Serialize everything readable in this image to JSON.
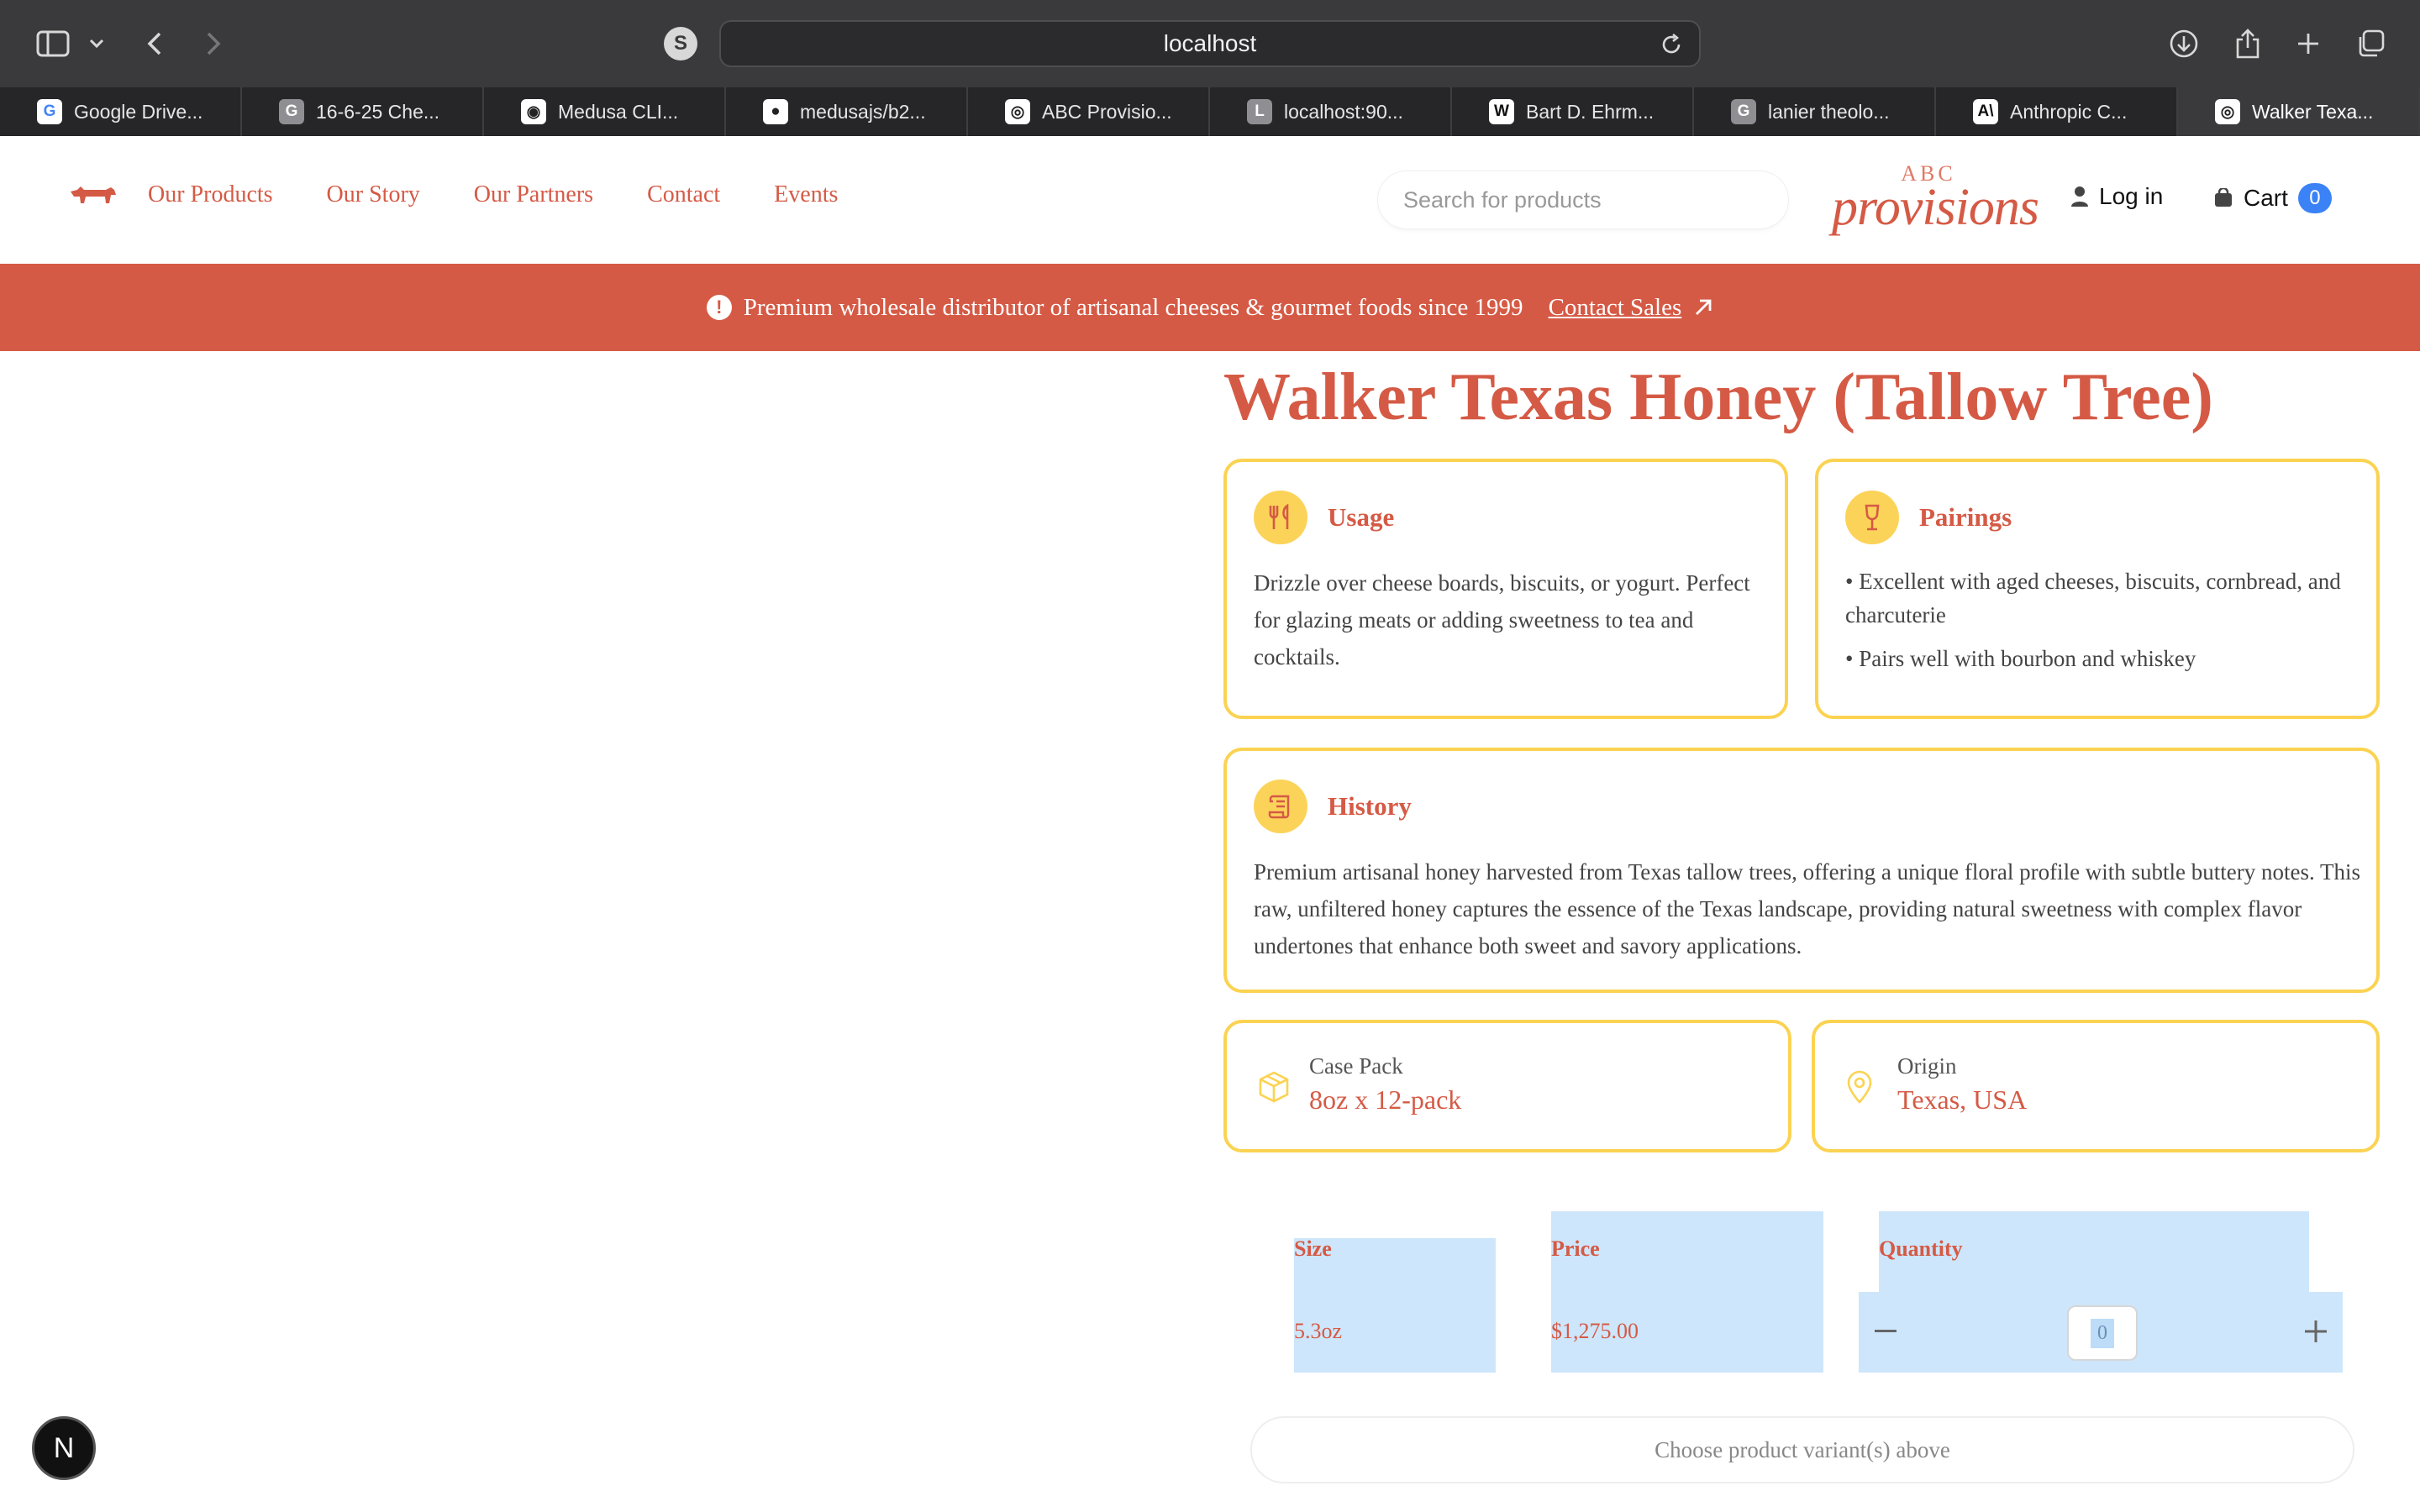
{
  "browser": {
    "url": "localhost",
    "site_badge": "S",
    "tabs": [
      {
        "label": "Google Drive...",
        "fav": "G",
        "fav_color": "#ffffff",
        "fav_fg": "#4285f4"
      },
      {
        "label": "16-6-25 Che...",
        "fav": "G",
        "fav_color": "#8e8e93",
        "fav_fg": "#ffffff"
      },
      {
        "label": "Medusa CLI...",
        "fav": "◉",
        "fav_color": "#ffffff",
        "fav_fg": "#222222"
      },
      {
        "label": "medusajs/b2...",
        "fav": "●",
        "fav_color": "#ffffff",
        "fav_fg": "#222222"
      },
      {
        "label": "ABC Provisio...",
        "fav": "◎",
        "fav_color": "#ffffff",
        "fav_fg": "#222222"
      },
      {
        "label": "localhost:90...",
        "fav": "L",
        "fav_color": "#8e8e93",
        "fav_fg": "#ffffff"
      },
      {
        "label": "Bart D. Ehrm...",
        "fav": "W",
        "fav_color": "#ffffff",
        "fav_fg": "#111111"
      },
      {
        "label": "lanier theolo...",
        "fav": "G",
        "fav_color": "#8e8e93",
        "fav_fg": "#ffffff"
      },
      {
        "label": "Anthropic C...",
        "fav": "A\\",
        "fav_color": "#ffffff",
        "fav_fg": "#111111"
      },
      {
        "label": "Walker Texa...",
        "fav": "◎",
        "fav_color": "#ffffff",
        "fav_fg": "#222222"
      }
    ]
  },
  "header": {
    "nav": [
      "Our Products",
      "Our Story",
      "Our Partners",
      "Contact",
      "Events"
    ],
    "search_placeholder": "Search for products",
    "brand_top": "ABC",
    "brand_main": "provisions",
    "login_label": "Log in",
    "cart_label": "Cart",
    "cart_count": "0"
  },
  "banner": {
    "text": "Premium wholesale distributor of artisanal cheeses & gourmet foods since 1999",
    "link": "Contact Sales"
  },
  "product": {
    "title": "Walker Texas Honey (Tallow Tree)",
    "usage": {
      "title": "Usage",
      "body": "Drizzle over cheese boards, biscuits, or yogurt. Perfect for glazing meats or adding sweetness to tea and cocktails."
    },
    "pairings": {
      "title": "Pairings",
      "items": [
        "• Excellent with aged cheeses, biscuits, cornbread, and charcuterie",
        "• Pairs well with bourbon and whiskey"
      ]
    },
    "history": {
      "title": "History",
      "body": "Premium artisanal honey harvested from Texas tallow trees, offering a unique floral profile with subtle buttery notes. This raw, unfiltered honey captures the essence of the Texas landscape, providing natural sweetness with complex flavor undertones that enhance both sweet and savory applications."
    },
    "case_pack": {
      "label": "Case Pack",
      "value": "8oz x 12-pack"
    },
    "origin": {
      "label": "Origin",
      "value": "Texas, USA"
    }
  },
  "variants": {
    "headers": {
      "size": "Size",
      "price": "Price",
      "quantity": "Quantity"
    },
    "rows": [
      {
        "size": "5.3oz",
        "price": "$1,275.00",
        "quantity": "0"
      }
    ],
    "cta": "Choose product variant(s) above"
  },
  "dev_badge": "N",
  "colors": {
    "accent": "#d55a45",
    "card_border": "#fbd352",
    "icon_bg": "#fcd359",
    "selection": "#cde6fb"
  }
}
